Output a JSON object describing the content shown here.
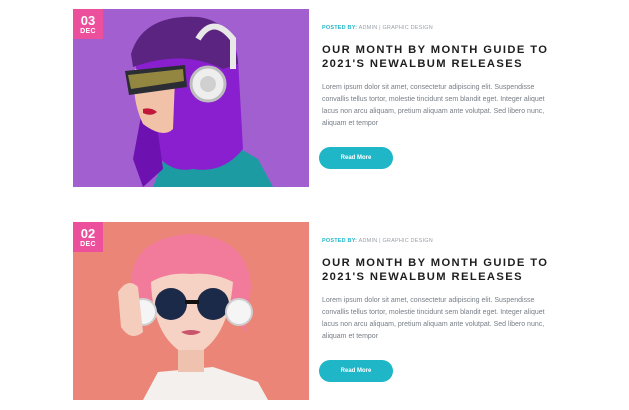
{
  "posts": [
    {
      "date_day": "03",
      "date_month": "DEC",
      "meta_posted_by": "POSTED BY:",
      "meta_rest": " ADMIN | GRAPHIC DESIGN",
      "title_line1": "OUR MONTH BY MONTH GUIDE TO",
      "title_line2": "2021'S NEWALBUM RELEASES",
      "excerpt": "Lorem ipsum dolor sit amet, consectetur adipiscing elit. Suspendisse convallis tellus tortor, molestie tincidunt sem blandit eget. Integer aliquet lacus non arcu aliquam, pretium aliquam ante volutpat. Sed libero nunc, aliquam et tempor",
      "button_label": "Read More",
      "image_bg": "#a25fd0"
    },
    {
      "date_day": "02",
      "date_month": "DEC",
      "meta_posted_by": "POSTED BY:",
      "meta_rest": " ADMIN | GRAPHIC DESIGN",
      "title_line1": "OUR MONTH BY MONTH GUIDE TO",
      "title_line2": "2021'S NEWALBUM RELEASES",
      "excerpt": "Lorem ipsum dolor sit amet, consectetur adipiscing elit. Suspendisse convallis tellus tortor, molestie tincidunt sem blandit eget. Integer aliquet lacus non arcu aliquam, pretium aliquam ante volutpat. Sed libero nunc, aliquam et tempor",
      "button_label": "Read More",
      "image_bg": "#ea8577"
    }
  ],
  "colors": {
    "accent_teal": "#1fb6c8",
    "badge_pink": "#ec4f9c"
  }
}
